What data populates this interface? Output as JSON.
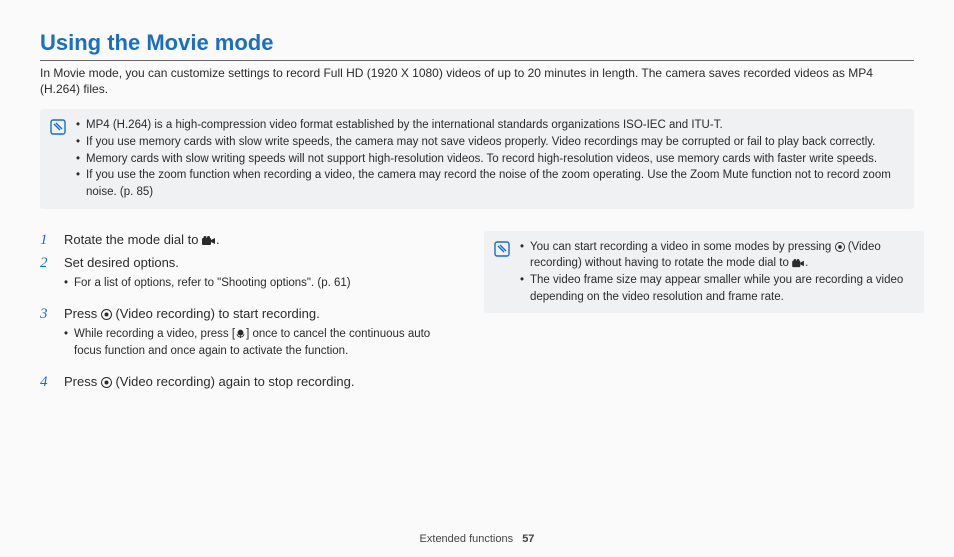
{
  "title": "Using the Movie mode",
  "intro": "In Movie mode, you can customize settings to record Full HD (1920 X 1080) videos of up to 20 minutes in length. The camera saves recorded videos as MP4 (H.264) files.",
  "top_notes": [
    "MP4 (H.264) is a high-compression video format established by the international standards organizations ISO-IEC and ITU-T.",
    "If you use memory cards with slow write speeds, the camera may not save videos properly. Video recordings may be corrupted or fail to play back correctly.",
    "Memory cards with slow writing speeds will not support high-resolution videos. To record high-resolution videos, use memory cards with faster write speeds.",
    "If you use the zoom function when recording a video, the camera may record the noise of the zoom operating. Use the Zoom Mute function not to record zoom noise. (p. 85)"
  ],
  "steps": [
    {
      "num": "1",
      "text_before": "Rotate the mode dial to ",
      "text_after": ".",
      "icon": "movie-mode-icon",
      "subs": []
    },
    {
      "num": "2",
      "text_before": "Set desired options.",
      "text_after": "",
      "icon": "",
      "subs": [
        "For a list of options, refer to \"Shooting options\". (p. 61)"
      ]
    },
    {
      "num": "3",
      "text_before": "Press ",
      "text_mid": " (Video recording) to start recording.",
      "icon": "record-button-icon",
      "subs_before": "While recording a video, press [",
      "subs_icon": "macro-icon",
      "subs_after": "] once to cancel the continuous auto focus function and once again to activate the function."
    },
    {
      "num": "4",
      "text_before": "Press ",
      "text_mid": " (Video recording) again to stop recording.",
      "icon": "record-button-icon",
      "subs": []
    }
  ],
  "right_notes": {
    "n1_before": "You can start recording a video in some modes by pressing ",
    "n1_mid": " (Video recording) without having to rotate the mode dial to ",
    "n1_after": ".",
    "n2": "The video frame size may appear smaller while you are recording a video depending on the video resolution and frame rate."
  },
  "footer": {
    "section": "Extended functions",
    "page": "57"
  }
}
